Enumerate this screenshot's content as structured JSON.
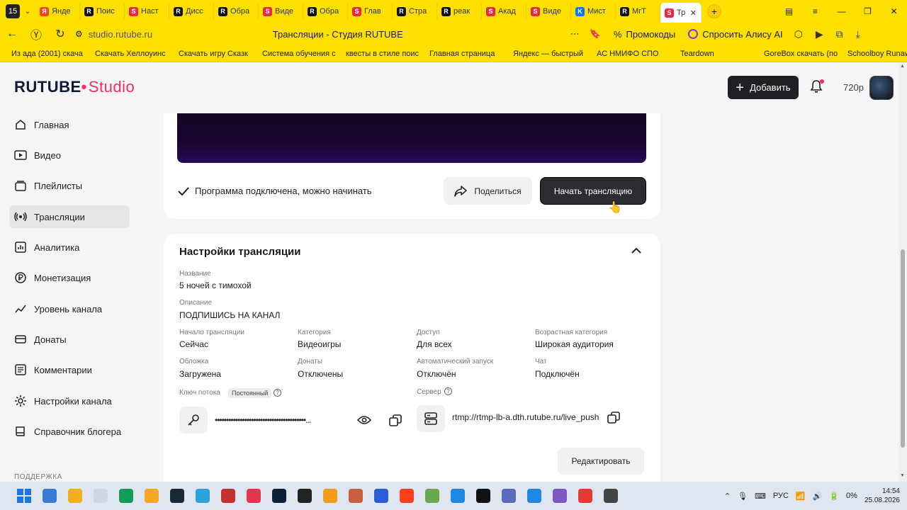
{
  "browser": {
    "tab_count": "15",
    "tabs": [
      {
        "label": "Янде",
        "color": "#fc3f1d",
        "glyph": "Я"
      },
      {
        "label": "Поис",
        "color": "#111111",
        "glyph": "R"
      },
      {
        "label": "Наст",
        "color": "#e6284a",
        "glyph": "S"
      },
      {
        "label": "Дисс",
        "color": "#111111",
        "glyph": "R"
      },
      {
        "label": "Обра",
        "color": "#111111",
        "glyph": "R"
      },
      {
        "label": "Виде",
        "color": "#e6284a",
        "glyph": "S"
      },
      {
        "label": "Обра",
        "color": "#111111",
        "glyph": "R"
      },
      {
        "label": "Глав",
        "color": "#e6284a",
        "glyph": "S"
      },
      {
        "label": "Стра",
        "color": "#111111",
        "glyph": "R"
      },
      {
        "label": "реак",
        "color": "#111111",
        "glyph": "R"
      },
      {
        "label": "Акад",
        "color": "#e6284a",
        "glyph": "S"
      },
      {
        "label": "Виде",
        "color": "#e6284a",
        "glyph": "S"
      },
      {
        "label": "Мист",
        "color": "#0077ff",
        "glyph": "K"
      },
      {
        "label": "МгТ",
        "color": "#111111",
        "glyph": "R"
      }
    ],
    "active_tab": {
      "label": "Тр",
      "close": "✕"
    },
    "url": "studio.rutube.ru",
    "page_title": "Трансляции - Студия RUTUBE",
    "promo_label": "Промокоды",
    "alice_label": "Спросить Алису AI",
    "bookmarks": [
      "Из ада (2001) скача",
      "Скачать Хеллоуинс",
      "Скачать игру Сказк",
      "Система обучения с",
      "квесты в стиле поис",
      "Главная страница",
      "Яндекс — быстрый",
      "АС НМИФО СПО",
      "Teardown",
      "GoreBox скачать (по",
      "Schoolboy Runaway"
    ]
  },
  "header": {
    "logo_main": "RUTUBE",
    "logo_dot": "•",
    "logo_studio": "Studio",
    "add_label": "Добавить",
    "quality": "720p"
  },
  "sidebar": {
    "items": [
      {
        "label": "Главная",
        "icon": "home-icon"
      },
      {
        "label": "Видео",
        "icon": "video-icon"
      },
      {
        "label": "Плейлисты",
        "icon": "playlist-icon"
      },
      {
        "label": "Трансляции",
        "icon": "broadcast-icon",
        "active": true
      },
      {
        "label": "Аналитика",
        "icon": "analytics-icon"
      },
      {
        "label": "Монетизация",
        "icon": "ruble-icon"
      },
      {
        "label": "Уровень канала",
        "icon": "level-icon"
      },
      {
        "label": "Донаты",
        "icon": "donate-icon"
      },
      {
        "label": "Комментарии",
        "icon": "comments-icon"
      },
      {
        "label": "Настройки канала",
        "icon": "gear-icon"
      },
      {
        "label": "Справочник блогера",
        "icon": "book-icon"
      }
    ],
    "support_label": "ПОДДЕРЖКА"
  },
  "stream": {
    "status_text": "Программа подключена, можно начинать",
    "share_label": "Поделиться",
    "start_label": "Начать трансляцию"
  },
  "settings": {
    "title": "Настройки трансляции",
    "name_label": "Название",
    "name_value": "5 ночей с тимохой",
    "description_label": "Описание",
    "description_value": "ПОДПИШИСЬ НА КАНАЛ",
    "start_label": "Начало трансляции",
    "start_value": "Сейчас",
    "category_label": "Категория",
    "category_value": "Видеоигры",
    "access_label": "Доступ",
    "access_value": "Для всех",
    "age_label": "Возрастная категория",
    "age_value": "Широкая аудитория",
    "cover_label": "Обложка",
    "cover_value": "Загружена",
    "donates_label": "Донаты",
    "donates_value": "Отключены",
    "autostart_label": "Автоматический запуск",
    "autostart_value": "Отключён",
    "chat_label": "Чат",
    "chat_value": "Подключён",
    "key_label": "Ключ потока",
    "key_tag": "Постоянный",
    "key_value": "••••••••••••••••••••••••••••••••••••••••...",
    "server_label": "Сервер",
    "server_value": "rtmp://rtmp-lb-a.dth.rutube.ru/live_push",
    "edit_label": "Редактировать"
  },
  "taskbar": {
    "lang": "РУС",
    "battery": "0%",
    "time": "14:54",
    "date": "25.08.2026"
  }
}
